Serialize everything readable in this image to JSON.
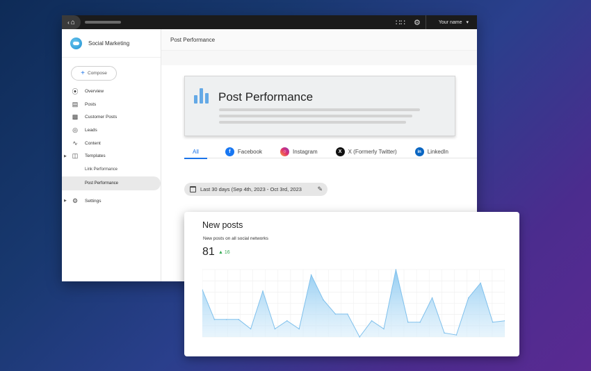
{
  "topbar": {
    "user_name": "Your name",
    "home_icon": "home-icon",
    "apps_icon": "apps-grid-icon",
    "settings_icon": "gear-icon"
  },
  "sidebar": {
    "brand": "Social Marketing",
    "compose_label": "Compose",
    "items": [
      {
        "label": "Overview",
        "icon": "compass-icon"
      },
      {
        "label": "Posts",
        "icon": "comment-icon"
      },
      {
        "label": "Customer Posts",
        "icon": "forum-icon"
      },
      {
        "label": "Leads",
        "icon": "target-icon"
      },
      {
        "label": "Content",
        "icon": "rss-icon"
      },
      {
        "label": "Templates",
        "icon": "chart-box-icon"
      }
    ],
    "sub_items": [
      {
        "label": "Link Performance"
      },
      {
        "label": "Post Performance"
      }
    ],
    "settings_label": "Settings"
  },
  "main": {
    "header_title": "Post Performance",
    "hero_title": "Post Performance",
    "tabs": [
      {
        "label": "All"
      },
      {
        "label": "Facebook"
      },
      {
        "label": "Instagram"
      },
      {
        "label": "X (Formerly Twitter)"
      },
      {
        "label": "LinkedIn"
      }
    ],
    "date_range": "Last 30 days (Sep 4th, 2023 - Oct 3rd, 2023"
  },
  "colors": {
    "accent": "#1a73e8",
    "positive": "#34a853",
    "chart_line": "#7fc0ec",
    "facebook": "#1877f2",
    "linkedin": "#0a66c2"
  },
  "new_posts_card": {
    "title": "New posts",
    "subtitle": "New posts on all social networks",
    "count": "81",
    "delta": "16"
  },
  "chart_data": {
    "type": "area",
    "title": "",
    "xlabel": "",
    "ylabel": "",
    "grid": true,
    "ylim": [
      0,
      100
    ],
    "series": [
      {
        "values": [
          70,
          26,
          26,
          26,
          12,
          68,
          12,
          24,
          12,
          92,
          55,
          34,
          34,
          0,
          24,
          12,
          100,
          22,
          22,
          58,
          6,
          3,
          58,
          80,
          22,
          24
        ]
      }
    ]
  }
}
